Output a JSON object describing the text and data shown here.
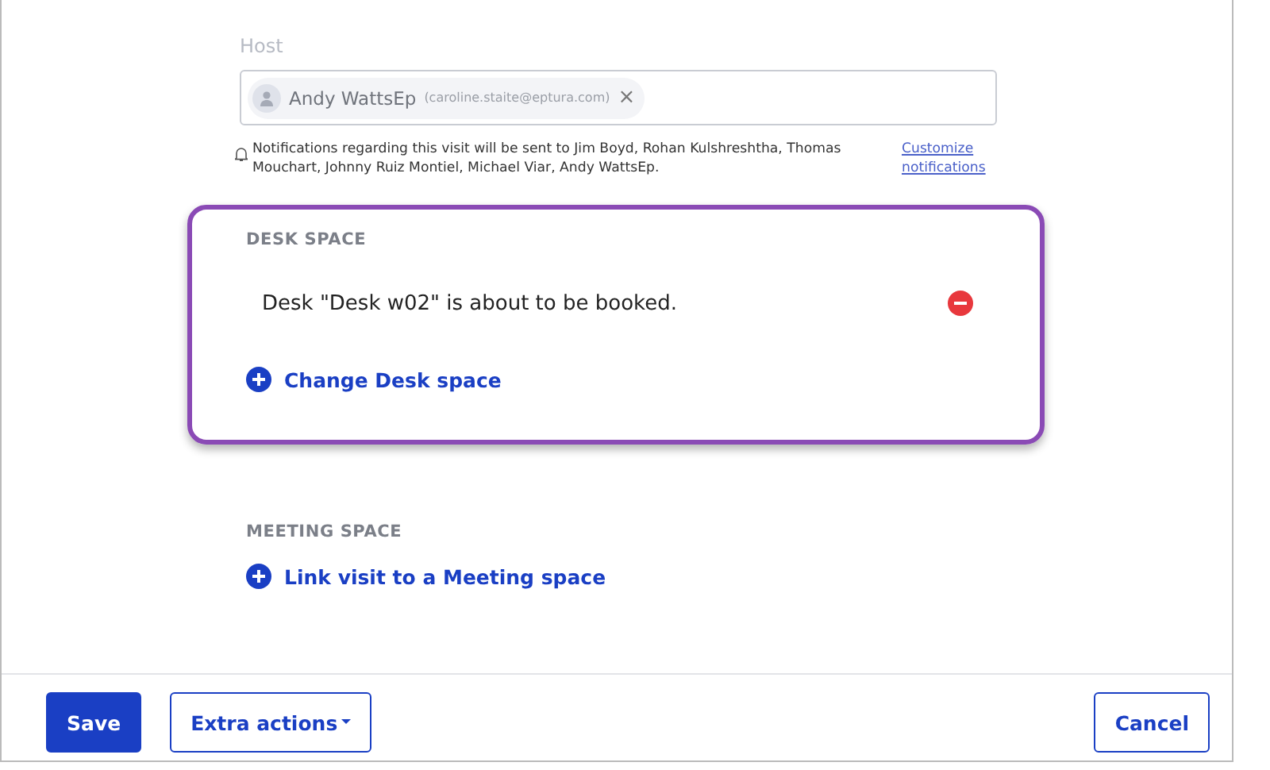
{
  "host": {
    "label": "Host",
    "chip": {
      "name": "Andy WattsEp",
      "email": "(caroline.staite@eptura.com)",
      "remove": "×"
    },
    "notice": "Notifications regarding this visit will be sent to Jim Boyd, Rohan Kulshreshtha, Thomas Mouchart, Johnny Ruiz Montiel, Michael Viar, Andy WattsEp.",
    "link": "Customize notifications"
  },
  "sections": [
    {
      "title": "DESK SPACE",
      "highlighted": true,
      "booking": "Desk \"Desk w02\" is about to be booked.",
      "action": "Change Desk space"
    },
    {
      "title": "MEETING SPACE",
      "highlighted": false,
      "action": "Link visit to a Meeting space"
    }
  ],
  "footer": {
    "buttons": [
      {
        "label": "Save",
        "kind": "primary"
      },
      {
        "label": "Extra actions",
        "kind": "menu"
      },
      {
        "label": "Cancel",
        "kind": "secondary"
      }
    ]
  }
}
